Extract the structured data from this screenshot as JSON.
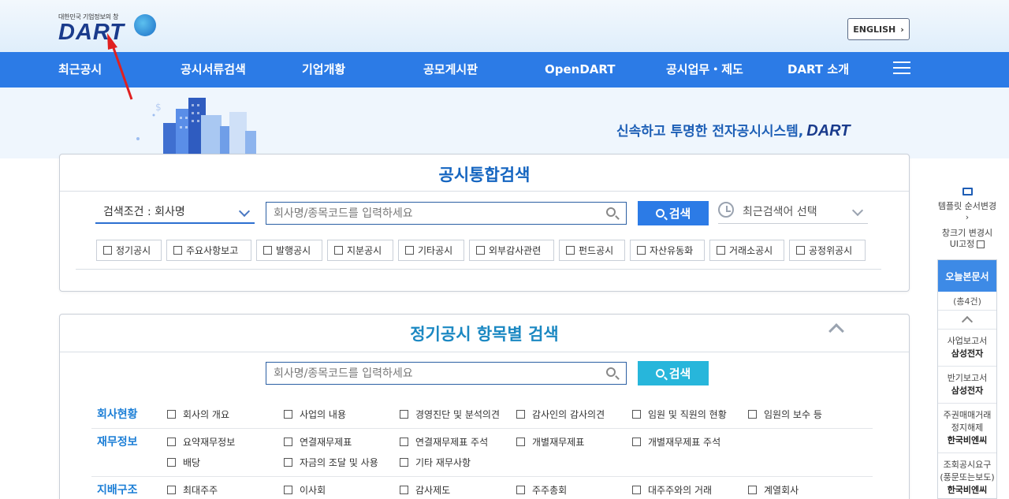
{
  "header": {
    "logo_subtitle": "대한민국 기업정보의 창",
    "logo_text": "DART",
    "english_button": "ENGLISH",
    "english_arrow": "›"
  },
  "nav": {
    "items": [
      "최근공시",
      "공시서류검색",
      "기업개황",
      "공모게시판",
      "OpenDART",
      "공시업무・제도",
      "DART 소개"
    ]
  },
  "hero": {
    "tagline": "신속하고 투명한 전자공시시스템,",
    "tagline_brand": "DART"
  },
  "integrated_search": {
    "title": "공시통합검색",
    "condition_label": "검색조건 : 회사명",
    "input_placeholder": "회사명/종목코드를 입력하세요",
    "search_button": "검색",
    "recent_label": "최근검색어 선택",
    "categories": [
      "정기공시",
      "주요사항보고",
      "발행공시",
      "지분공시",
      "기타공시",
      "외부감사관련",
      "펀드공시",
      "자산유동화",
      "거래소공시",
      "공정위공시"
    ]
  },
  "item_search": {
    "title": "정기공시 항목별 검색",
    "input_placeholder": "회사명/종목코드를 입력하세요",
    "search_button": "검색",
    "groups": [
      {
        "label": "회사현황",
        "items": [
          "회사의 개요",
          "사업의 내용",
          "경영진단 및 분석의견",
          "감사인의 감사의견",
          "임원 및 직원의 현황",
          "임원의 보수 등"
        ]
      },
      {
        "label": "재무정보",
        "items": [
          "요약재무정보",
          "연결재무제표",
          "연결재무제표 주석",
          "개별재무제표",
          "개별재무제표 주석",
          "배당",
          "자금의 조달 및 사용",
          "기타 재무사항"
        ]
      },
      {
        "label": "지배구조",
        "items": [
          "최대주주",
          "이사회",
          "감사제도",
          "주주총회",
          "대주주와의 거래",
          "계열회사"
        ]
      }
    ]
  },
  "sidebar": {
    "template_label": "템플릿 순서변경",
    "template_arrow": "›",
    "fix_line1": "창크기 변경시",
    "fix_line2": "UI고정",
    "today_title": "오늘본문서",
    "today_count": "(총4건)",
    "docs": [
      {
        "type": "사업보고서",
        "company": "삼성전자"
      },
      {
        "type": "반기보고서",
        "company": "삼성전자"
      },
      {
        "type": "주권매매거래정지해제",
        "company": "한국비엔씨"
      },
      {
        "type": "조회공시요구(풍문또는보도)",
        "company": "한국비엔씨"
      }
    ]
  },
  "colors": {
    "nav_bg": "#2c7be6",
    "brand_navy": "#1a3b8c",
    "title_blue": "#1565c0",
    "item_title_blue": "#1b88c2",
    "cyan_button": "#27b6db",
    "annotation_arrow": "#e02020"
  }
}
